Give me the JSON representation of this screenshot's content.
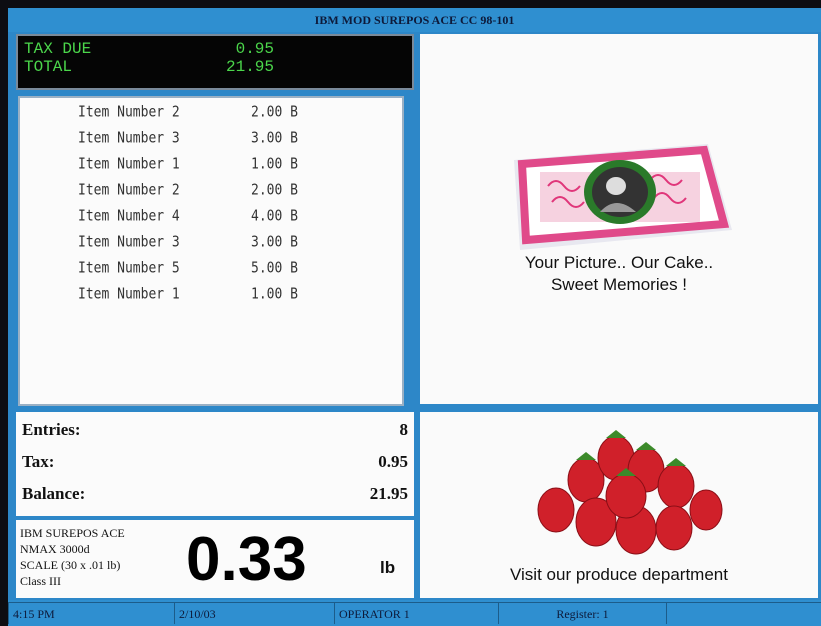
{
  "window": {
    "title": "IBM MOD SUREPOS ACE CC 98-101"
  },
  "totals": {
    "tax_due_label": "TAX DUE",
    "tax_due_value": "0.95",
    "total_label": "TOTAL",
    "total_value": "21.95"
  },
  "items": [
    {
      "name": "Item Number 2",
      "price": "2.00 B"
    },
    {
      "name": "Item Number 3",
      "price": "3.00 B"
    },
    {
      "name": "Item Number 1",
      "price": "1.00 B"
    },
    {
      "name": "Item Number 2",
      "price": "2.00 B"
    },
    {
      "name": "Item Number 4",
      "price": "4.00 B"
    },
    {
      "name": "Item Number 3",
      "price": "3.00 B"
    },
    {
      "name": "Item Number 5",
      "price": "5.00 B"
    },
    {
      "name": "Item Number 1",
      "price": "1.00 B"
    }
  ],
  "summary": {
    "entries_label": "Entries:",
    "entries_value": "8",
    "tax_label": "Tax:",
    "tax_value": "0.95",
    "balance_label": "Balance:",
    "balance_value": "21.95"
  },
  "scale": {
    "line1": "IBM SUREPOS ACE",
    "line2": "NMAX 3000d",
    "line3": "SCALE (30 x .01 lb)",
    "line4": "Class III",
    "weight": "0.33",
    "unit": "lb"
  },
  "promos": {
    "cake_line1": "Your Picture.. Our Cake..",
    "cake_line2": "Sweet Memories !",
    "produce": "Visit our produce department"
  },
  "status": {
    "time": "4:15 PM",
    "date": "2/10/03",
    "operator": "OPERATOR 1",
    "register": "Register: 1"
  },
  "colors": {
    "frame": "#2d87c8",
    "totals_text": "#4bd64b"
  }
}
